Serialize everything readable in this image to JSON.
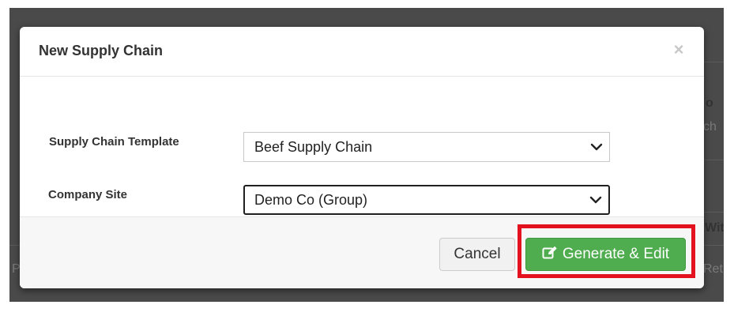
{
  "background": {
    "partial_texts": [
      "o",
      "ch",
      "Wit",
      "Ret",
      "P"
    ]
  },
  "modal": {
    "title": "New Supply Chain",
    "close_symbol": "×",
    "fields": [
      {
        "label": "Supply Chain Template",
        "value": "Beef Supply Chain"
      },
      {
        "label": "Company Site",
        "value": "Demo Co (Group)"
      }
    ],
    "buttons": {
      "cancel_label": "Cancel",
      "generate_label": "Generate & Edit"
    },
    "icons": {
      "close": "close-icon",
      "dropdown": "chevron-down-icon",
      "generate": "edit-icon"
    }
  },
  "colors": {
    "primary_button": "#4fad4f",
    "highlight": "#e4121e",
    "backdrop": "#4a4a4a"
  }
}
